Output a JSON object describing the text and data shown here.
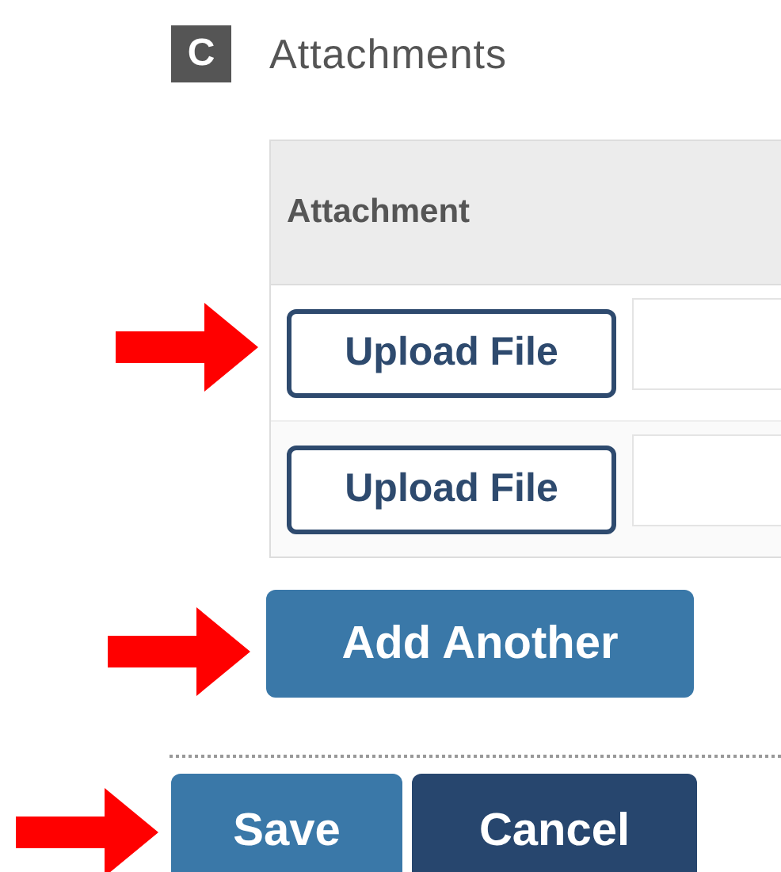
{
  "section": {
    "badge": "C",
    "title": "Attachments"
  },
  "table": {
    "columns": [
      "Attachment"
    ],
    "rows": [
      {
        "button": "Upload File",
        "arrow": true
      },
      {
        "button": "Upload File",
        "arrow": false
      }
    ]
  },
  "add_button": {
    "label": "Add Another",
    "arrow": true
  },
  "actions": [
    {
      "label": "Save",
      "kind": "primary",
      "arrow": true
    },
    {
      "label": "Cancel",
      "kind": "secondary",
      "arrow": false
    }
  ]
}
